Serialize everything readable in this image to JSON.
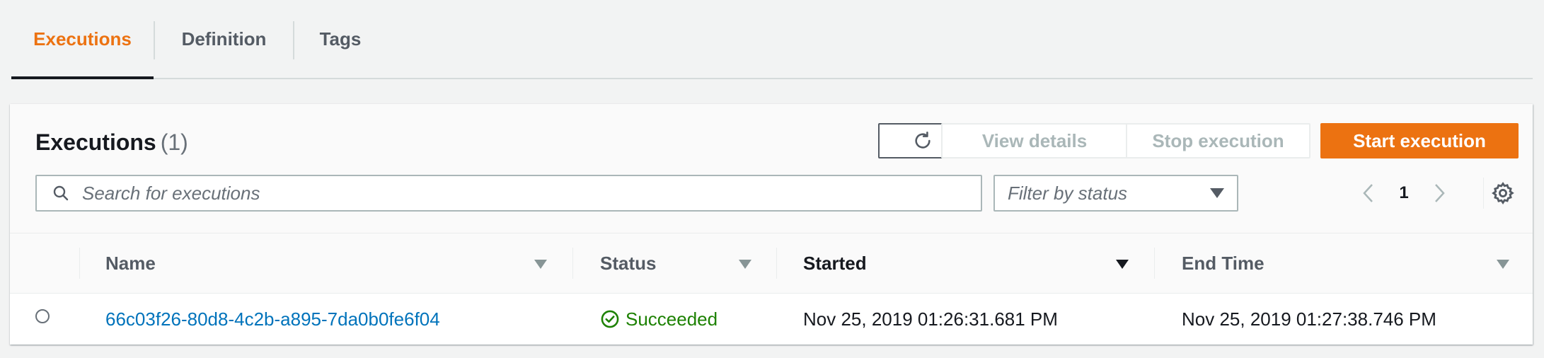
{
  "tabs": [
    {
      "label": "Executions",
      "active": true
    },
    {
      "label": "Definition",
      "active": false
    },
    {
      "label": "Tags",
      "active": false
    }
  ],
  "panel": {
    "title": "Executions",
    "count": "(1)",
    "buttons": {
      "refresh_icon": "refresh-icon",
      "view_details": "View details",
      "stop_execution": "Stop execution",
      "start_execution": "Start execution"
    },
    "search": {
      "placeholder": "Search for executions",
      "value": ""
    },
    "filter": {
      "placeholder": "Filter by status"
    },
    "pagination": {
      "current_page": "1"
    },
    "colors": {
      "accent": "#ec7211",
      "link": "#0073bb",
      "success": "#1d8102"
    }
  },
  "table": {
    "columns": [
      "Name",
      "Status",
      "Started",
      "End Time"
    ],
    "sorted_column": "Started",
    "rows": [
      {
        "name": "66c03f26-80d8-4c2b-a895-7da0b0fe6f04",
        "status": "Succeeded",
        "status_icon": "check-circle-icon",
        "started": "Nov 25, 2019 01:26:31.681 PM",
        "end_time": "Nov 25, 2019 01:27:38.746 PM"
      }
    ]
  }
}
